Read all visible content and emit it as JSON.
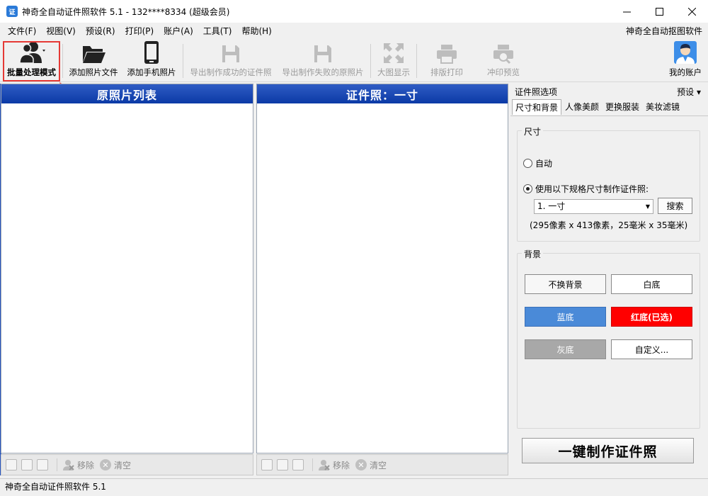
{
  "window": {
    "title": "神奇全自动证件照软件 5.1 - 132****8334 (超级会员)",
    "app_icon_text": "证"
  },
  "menubar": {
    "items": [
      "文件(F)",
      "视图(V)",
      "预设(R)",
      "打印(P)",
      "账户(A)",
      "工具(T)",
      "帮助(H)"
    ],
    "right_link": "神奇全自动抠图软件"
  },
  "toolbar": {
    "batch_mode": "批量处理模式",
    "add_photo_file": "添加照片文件",
    "add_phone_photo": "添加手机照片",
    "export_success": "导出制作成功的证件照",
    "export_failed": "导出制作失败的原照片",
    "large_view": "大图显示",
    "layout_print": "排版打印",
    "print_preview": "冲印预览",
    "my_account": "我的账户"
  },
  "left_panel": {
    "title": "原照片列表",
    "footer": {
      "remove": "移除",
      "clear": "清空"
    }
  },
  "middle_panel": {
    "title": "证件照：一寸",
    "footer": {
      "remove": "移除",
      "clear": "清空"
    }
  },
  "options": {
    "heading": "证件照选项",
    "preset": "预设",
    "tabs": [
      "尺寸和背景",
      "人像美颜",
      "更换服装",
      "美妆滤镜"
    ],
    "active_tab": 0,
    "size": {
      "group_title": "尺寸",
      "auto_label": "自动",
      "spec_label": "使用以下规格尺寸制作证件照:",
      "auto_selected": false,
      "spec_selected": true,
      "selected_spec": "1. 一寸",
      "search_button": "搜索",
      "dimensions": "(295像素 x 413像素，25毫米 x 35毫米)"
    },
    "background": {
      "group_title": "背景",
      "buttons": {
        "keep": "不换背景",
        "white": "白底",
        "blue": "蓝底",
        "red": "红底(已选)",
        "gray": "灰底",
        "custom": "自定义..."
      },
      "colors": {
        "blue": "#4a8ad8",
        "red": "#ff0000",
        "gray": "#a8a8a8"
      },
      "selected": "red"
    },
    "make_button": "一键制作证件照"
  },
  "statusbar": {
    "text": "神奇全自动证件照软件 5.1"
  }
}
